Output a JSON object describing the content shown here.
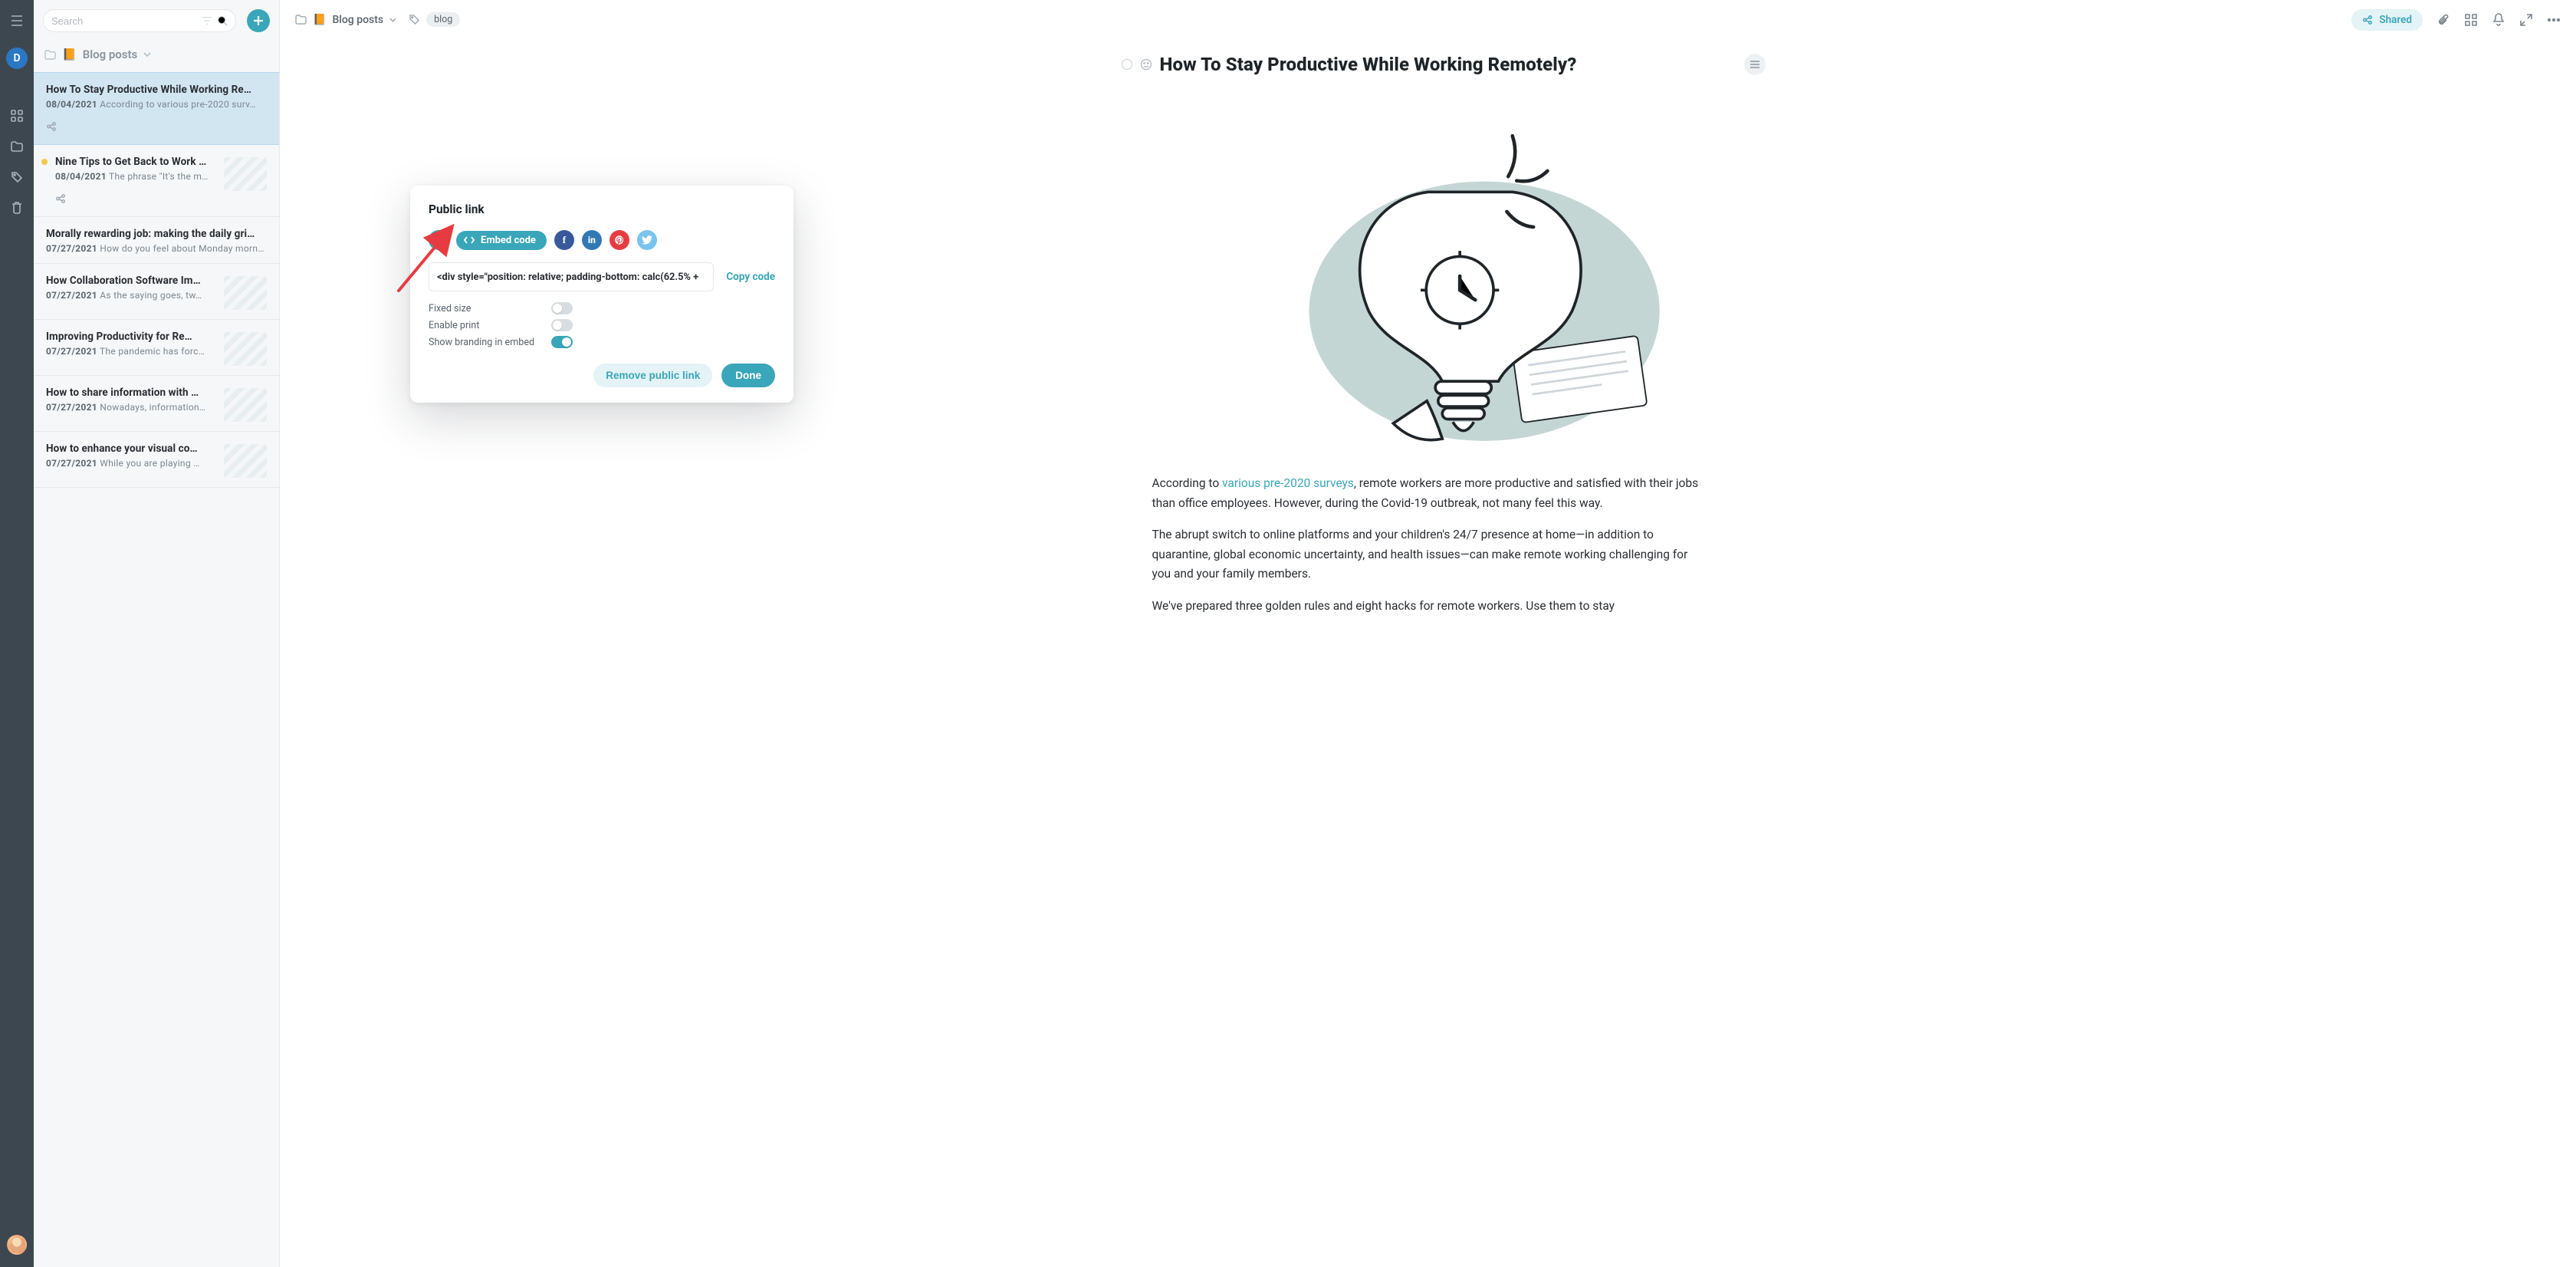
{
  "search": {
    "placeholder": "Search"
  },
  "avatar_letter": "D",
  "breadcrumb": {
    "label": "Blog posts"
  },
  "notes": [
    {
      "title": "How To Stay Productive While Working Re…",
      "date": "08/04/2021",
      "excerpt": "According to various pre-2020 surv…",
      "selected": true,
      "share": true,
      "thumb": false
    },
    {
      "title": "Nine Tips to Get Back to Work …",
      "date": "08/04/2021",
      "excerpt": "The phrase \"It's the m…",
      "yellow": true,
      "share": true,
      "thumb": true
    },
    {
      "title": "Morally rewarding job: making the daily gri…",
      "date": "07/27/2021",
      "excerpt": "How do you feel about Monday morn…",
      "thumb": false
    },
    {
      "title": "How Collaboration Software Im…",
      "date": "07/27/2021",
      "excerpt": "As the saying goes, tw…",
      "thumb": true
    },
    {
      "title": "Improving Productivity for Re…",
      "date": "07/27/2021",
      "excerpt": "The pandemic has forc…",
      "thumb": true
    },
    {
      "title": "How to share information with …",
      "date": "07/27/2021",
      "excerpt": "Nowadays, information…",
      "thumb": true
    },
    {
      "title": "How to enhance your visual co…",
      "date": "07/27/2021",
      "excerpt": "While you are playing …",
      "thumb": true
    }
  ],
  "topbar": {
    "breadcrumb": "Blog posts",
    "tag": "blog",
    "shared_label": "Shared"
  },
  "doc": {
    "title": "How To Stay Productive While Working Remotely?",
    "para1_pre": "According to ",
    "para1_link": "various pre-2020 surveys",
    "para1_post": ", remote workers are more productive and satisfied with their jobs than office employees. However, during the Covid-19 outbreak, not many feel this way.",
    "para2": "The abrupt switch to online platforms and your children's 24/7 presence at home—in addition to quarantine, global economic uncertainty, and health issues—can make remote working challenging for you and your family members.",
    "para3": "We've prepared three golden rules and eight hacks for remote workers. Use them to stay"
  },
  "modal": {
    "title": "Public link",
    "embed_label": "Embed code",
    "code_value": "<div style=\"position: relative; padding-bottom: calc(62.5% +",
    "copy_label": "Copy code",
    "opt_fixed": "Fixed size",
    "opt_print": "Enable print",
    "opt_branding": "Show branding in embed",
    "remove_label": "Remove public link",
    "done_label": "Done"
  }
}
